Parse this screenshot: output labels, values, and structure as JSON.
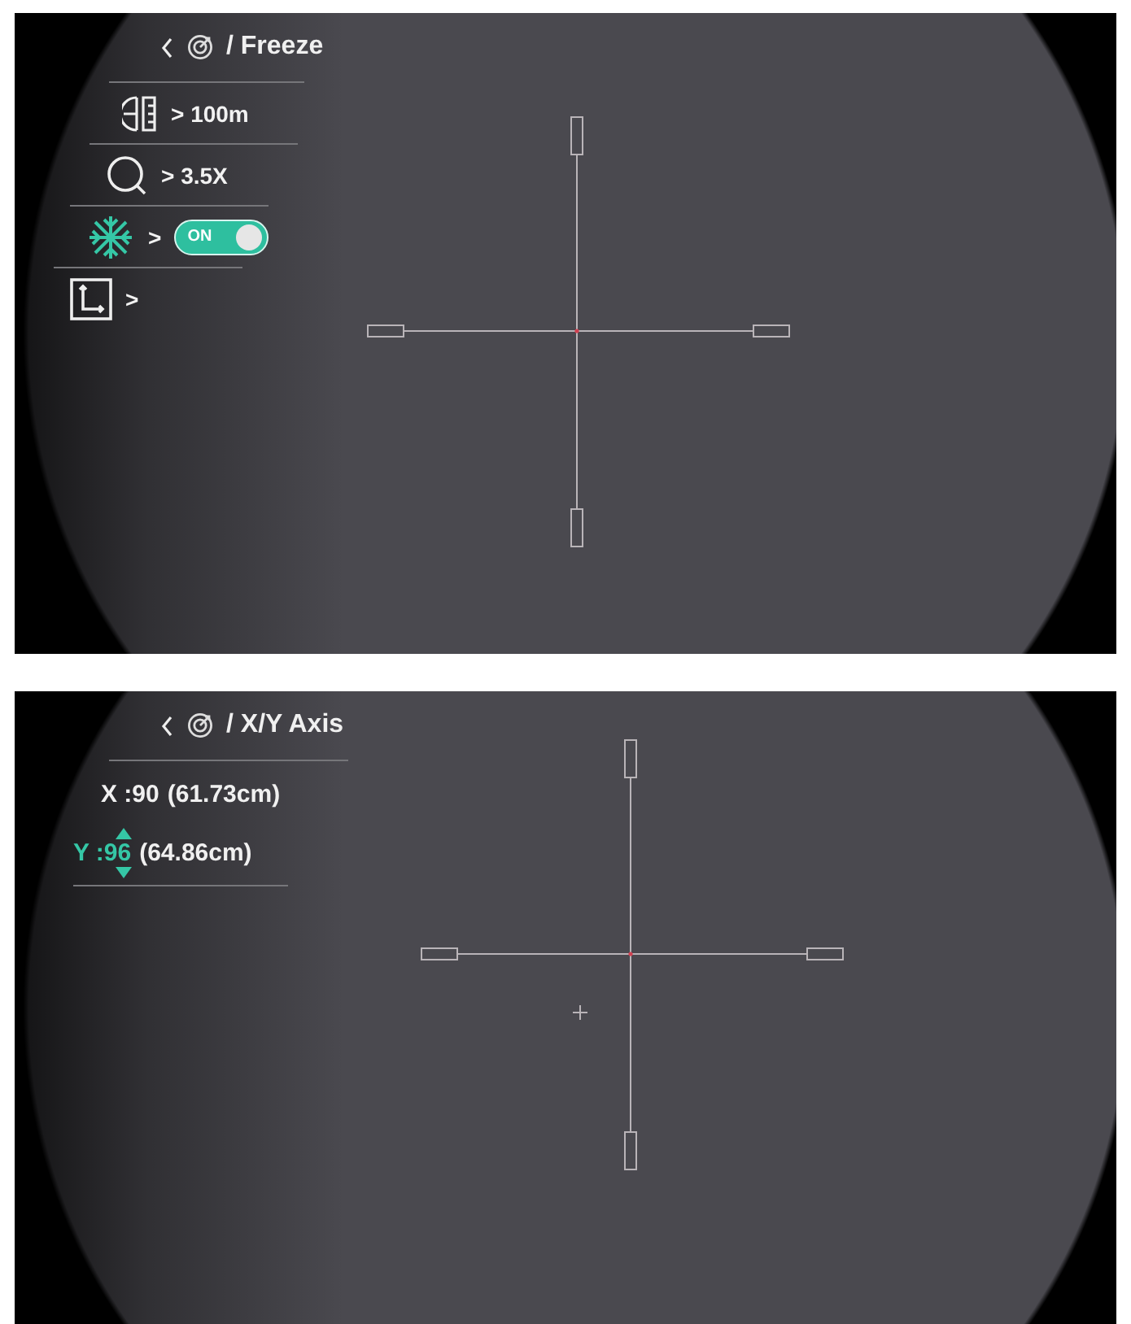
{
  "screens": [
    {
      "title": "/ Freeze",
      "menu": [
        {
          "kind": "value",
          "text": "> 100m",
          "selected": false
        },
        {
          "kind": "value",
          "text": "> 3.5X",
          "selected": false
        },
        {
          "kind": "toggle",
          "text": ">",
          "switch_label": "ON",
          "on": true,
          "selected": true
        },
        {
          "kind": "link",
          "text": ">",
          "selected": false
        }
      ]
    },
    {
      "title": "/ X/Y Axis",
      "axes": [
        {
          "label": "X :90",
          "detail": "(61.73cm)",
          "selected": false
        },
        {
          "label": "Y :96",
          "detail": "(64.86cm)",
          "selected": true
        }
      ]
    }
  ]
}
